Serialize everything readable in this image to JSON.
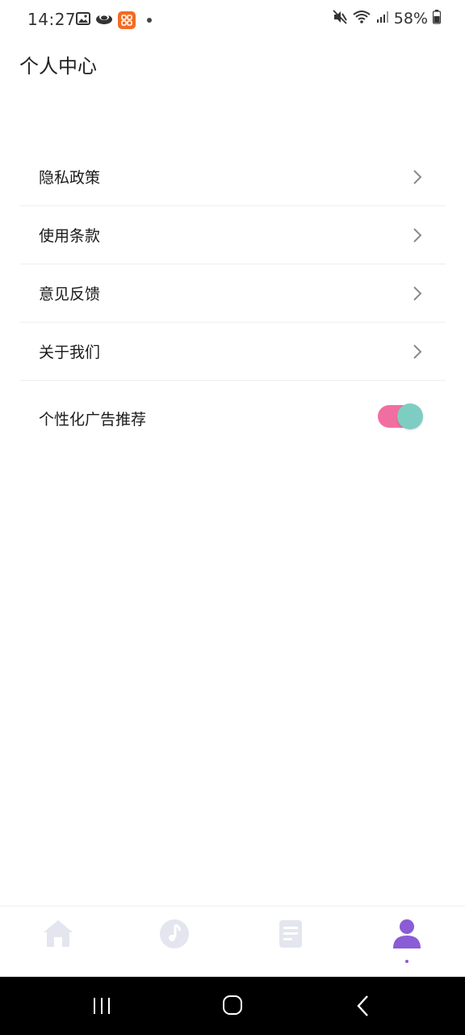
{
  "status_bar": {
    "time": "14:27",
    "battery": "58%",
    "icons": [
      "gallery-icon",
      "cloud-icon",
      "app-notification-icon",
      "dot-icon",
      "mute-icon",
      "wifi-icon",
      "signal-icon",
      "battery-icon"
    ]
  },
  "page": {
    "title": "个人中心"
  },
  "menu": {
    "items": [
      {
        "label": "隐私政策",
        "icon": "chevron-right-icon"
      },
      {
        "label": "使用条款",
        "icon": "chevron-right-icon"
      },
      {
        "label": "意见反馈",
        "icon": "chevron-right-icon"
      },
      {
        "label": "关于我们",
        "icon": "chevron-right-icon"
      }
    ],
    "toggle": {
      "label": "个性化广告推荐",
      "on": true
    }
  },
  "bottom_nav": {
    "items": [
      {
        "icon": "home-icon",
        "active": false
      },
      {
        "icon": "music-note-icon",
        "active": false
      },
      {
        "icon": "document-list-icon",
        "active": false
      },
      {
        "icon": "profile-icon",
        "active": true
      }
    ],
    "active_color": "#8a5cd6",
    "inactive_color": "#e3e6ee"
  },
  "colors": {
    "toggle_track": "#f16fa0",
    "toggle_knob": "#7ecdc3",
    "divider": "#efefef"
  }
}
